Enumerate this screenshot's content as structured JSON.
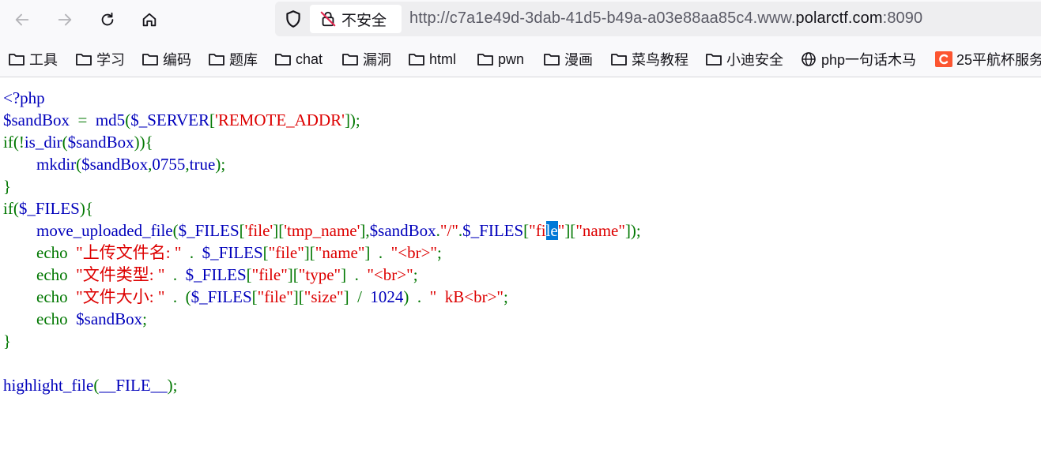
{
  "browser": {
    "security_label": "不安全",
    "url_prefix": "http://c7a1e49d-3dab-41d5-b49a-a03e88aa85c4.www.",
    "url_domain": "polarctf.com",
    "url_suffix": ":8090"
  },
  "bookmarks": [
    {
      "label": "工具",
      "icon": "folder-icon"
    },
    {
      "label": "学习",
      "icon": "folder-icon"
    },
    {
      "label": "编码",
      "icon": "folder-icon"
    },
    {
      "label": "题库",
      "icon": "folder-icon"
    },
    {
      "label": "chat",
      "icon": "folder-icon"
    },
    {
      "label": "漏洞",
      "icon": "folder-icon"
    },
    {
      "label": "html",
      "icon": "folder-icon"
    },
    {
      "label": "pwn",
      "icon": "folder-icon"
    },
    {
      "label": "漫画",
      "icon": "folder-icon"
    },
    {
      "label": "菜鸟教程",
      "icon": "folder-icon"
    },
    {
      "label": "小迪安全",
      "icon": "folder-icon"
    },
    {
      "label": "php一句话木马",
      "icon": "globe-icon"
    },
    {
      "label": "25平航杯服务",
      "icon": "csdn-icon"
    }
  ],
  "code_lines": [
    [
      [
        "<?php",
        "v"
      ]
    ],
    [
      [
        "$sandBox",
        "v"
      ],
      [
        "  =  ",
        "k"
      ],
      [
        "md5",
        "v"
      ],
      [
        "(",
        "k"
      ],
      [
        "$_SERVER",
        "v"
      ],
      [
        "[",
        "k"
      ],
      [
        "'REMOTE_ADDR'",
        "s"
      ],
      [
        "]);",
        "k"
      ]
    ],
    [
      [
        "if(!",
        "k"
      ],
      [
        "is_dir",
        "v"
      ],
      [
        "(",
        "k"
      ],
      [
        "$sandBox",
        "v"
      ],
      [
        ")){",
        "k"
      ]
    ],
    [
      [
        "        ",
        "k"
      ],
      [
        "mkdir",
        "v"
      ],
      [
        "(",
        "k"
      ],
      [
        "$sandBox",
        "v"
      ],
      [
        ",",
        "k"
      ],
      [
        "0755",
        "v"
      ],
      [
        ",",
        "k"
      ],
      [
        "true",
        "v"
      ],
      [
        ");",
        "k"
      ]
    ],
    [
      [
        "}",
        "k"
      ]
    ],
    [
      [
        "if(",
        "k"
      ],
      [
        "$_FILES",
        "v"
      ],
      [
        "){",
        "k"
      ]
    ],
    [
      [
        "        ",
        "k"
      ],
      [
        "move_uploaded_file",
        "v"
      ],
      [
        "(",
        "k"
      ],
      [
        "$_FILES",
        "v"
      ],
      [
        "[",
        "k"
      ],
      [
        "'file'",
        "s"
      ],
      [
        "][",
        "k"
      ],
      [
        "'tmp_name'",
        "s"
      ],
      [
        "],",
        "k"
      ],
      [
        "$sandBox",
        "v"
      ],
      [
        ".",
        "k"
      ],
      [
        "\"/\"",
        "s"
      ],
      [
        ".",
        "k"
      ],
      [
        "$_FILES",
        "v"
      ],
      [
        "[",
        "k"
      ],
      [
        "\"fi",
        "s"
      ],
      [
        "le",
        "hl"
      ],
      [
        "\"",
        "s"
      ],
      [
        "][",
        "k"
      ],
      [
        "\"name\"",
        "s"
      ],
      [
        "]);",
        "k"
      ]
    ],
    [
      [
        "        echo  ",
        "k"
      ],
      [
        "\"上传文件名: \"",
        "s"
      ],
      [
        "  .  ",
        "k"
      ],
      [
        "$_FILES",
        "v"
      ],
      [
        "[",
        "k"
      ],
      [
        "\"file\"",
        "s"
      ],
      [
        "][",
        "k"
      ],
      [
        "\"name\"",
        "s"
      ],
      [
        "]  .  ",
        "k"
      ],
      [
        "\"<br>\"",
        "s"
      ],
      [
        ";",
        "k"
      ]
    ],
    [
      [
        "        echo  ",
        "k"
      ],
      [
        "\"文件类型: \"",
        "s"
      ],
      [
        "  .  ",
        "k"
      ],
      [
        "$_FILES",
        "v"
      ],
      [
        "[",
        "k"
      ],
      [
        "\"file\"",
        "s"
      ],
      [
        "][",
        "k"
      ],
      [
        "\"type\"",
        "s"
      ],
      [
        "]  .  ",
        "k"
      ],
      [
        "\"<br>\"",
        "s"
      ],
      [
        ";",
        "k"
      ]
    ],
    [
      [
        "        echo  ",
        "k"
      ],
      [
        "\"文件大小: \"",
        "s"
      ],
      [
        "  .  ",
        "k"
      ],
      [
        "(",
        "k"
      ],
      [
        "$_FILES",
        "v"
      ],
      [
        "[",
        "k"
      ],
      [
        "\"file\"",
        "s"
      ],
      [
        "][",
        "k"
      ],
      [
        "\"size\"",
        "s"
      ],
      [
        "]  /  ",
        "k"
      ],
      [
        "1024",
        "v"
      ],
      [
        ")  .  ",
        "k"
      ],
      [
        "\"  kB<br>\"",
        "s"
      ],
      [
        ";",
        "k"
      ]
    ],
    [
      [
        "        echo  ",
        "k"
      ],
      [
        "$sandBox",
        "v"
      ],
      [
        ";",
        "k"
      ]
    ],
    [
      [
        "}",
        "k"
      ]
    ],
    [
      [
        "",
        "k"
      ]
    ],
    [
      [
        "highlight_file",
        "v"
      ],
      [
        "(",
        "k"
      ],
      [
        "__FILE__",
        "v"
      ],
      [
        ");",
        "k"
      ]
    ]
  ]
}
